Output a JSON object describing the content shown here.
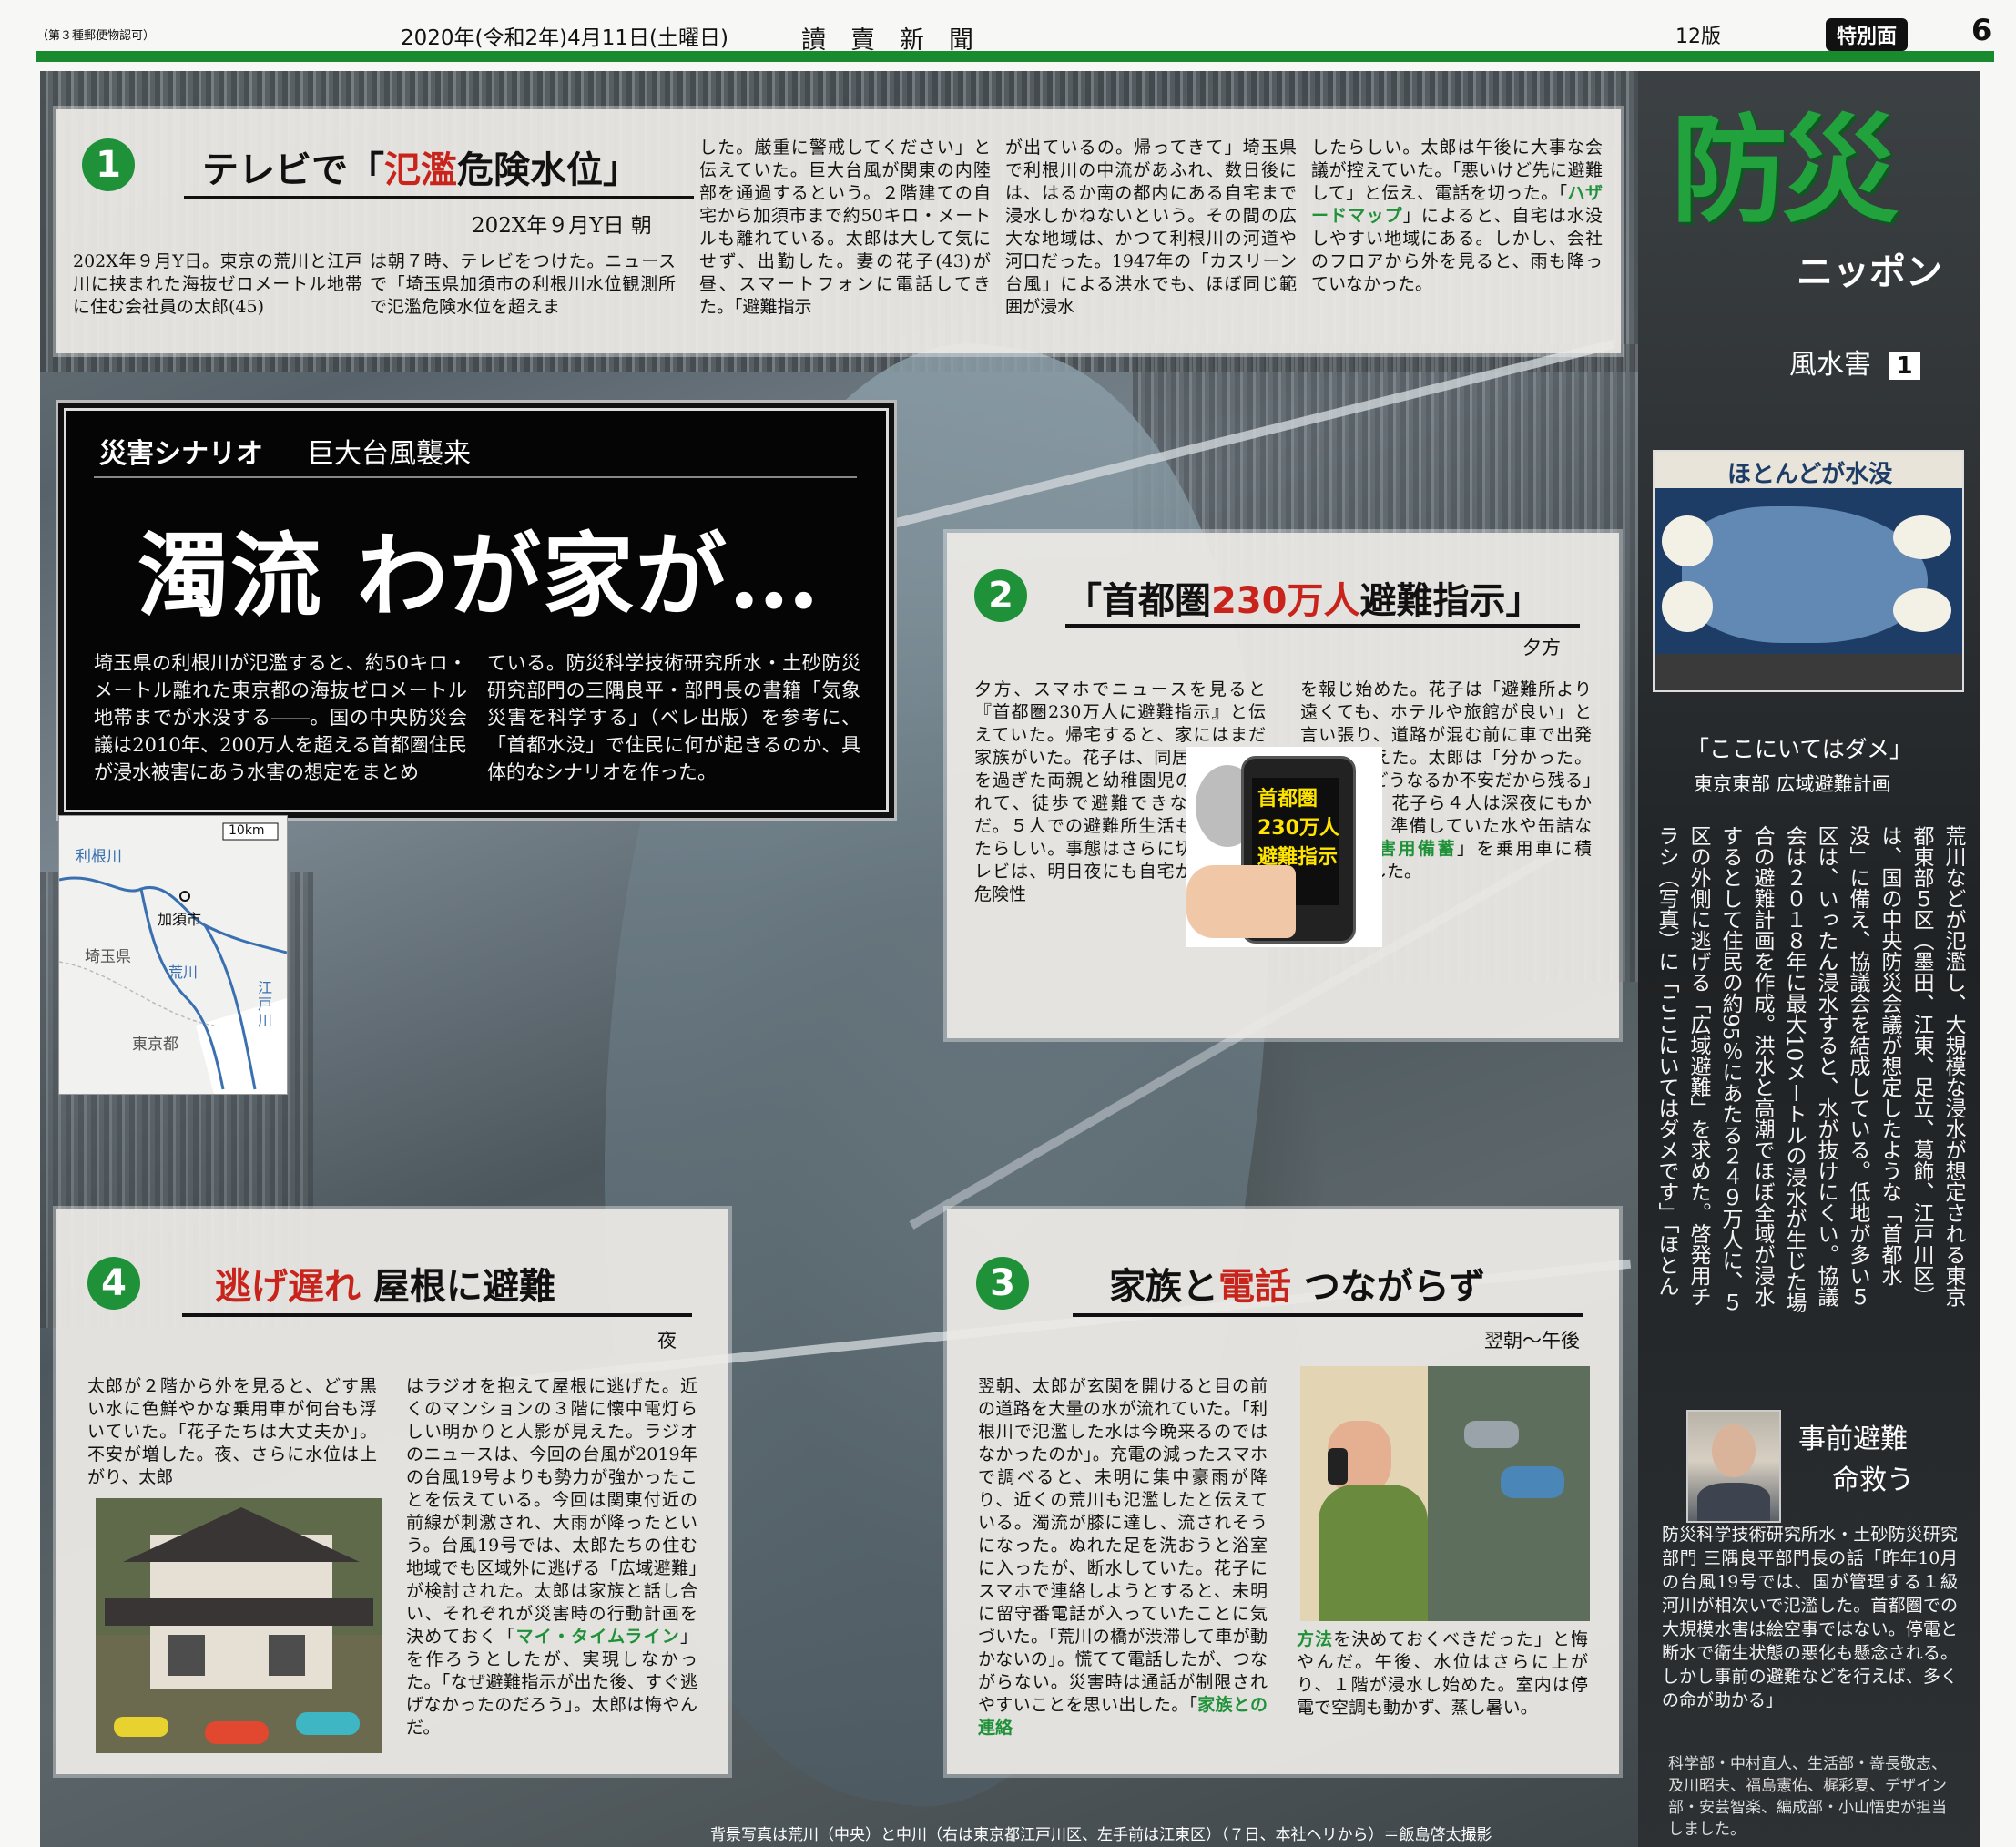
{
  "masthead": {
    "permit": "（第３種郵便物認可）",
    "date": "2020年(令和2年)4月11日(土曜日)",
    "paper": "讀　賣　新　聞",
    "edition": "12版",
    "section_badge": "特別面",
    "page": "6"
  },
  "series": {
    "title": "防災",
    "subtitle": "ニッポン",
    "topic": "風水害",
    "topic_no": "1"
  },
  "lead_panel": {
    "kicker": "災害シナリオ",
    "kicker2": "巨大台風襲来",
    "headline": "濁流 わが家が…",
    "lead_left": "埼玉県の利根川が氾濫すると、約50キロ・メートル離れた東京都の海抜ゼロメートル地帯までが水没する――。国の中央防災会議は2010年、200万人を超える首都圏住民が浸水被害にあう水害の想定をまとめ",
    "lead_right": "ている。防災科学技術研究所水・土砂防災研究部門の三隅良平・部門長の書籍「気象災害を科学する」（ベレ出版）を参考に、「首都水没」で住民に何が起きるのか、具体的なシナリオを作った。"
  },
  "map": {
    "scale": "10km",
    "tone_river": "利根川",
    "city": "加須市",
    "pref_saitama": "埼玉県",
    "ara": "荒川",
    "edo": "江戸川",
    "tokyo": "東京都"
  },
  "s1": {
    "num": "1",
    "head_pre": "テレビで「",
    "head_hl": "氾濫",
    "head_post": "危険水位」",
    "time": "202X年９月Y日 朝",
    "c1": "202X年９月Y日。東京の荒川と江戸川に挟まれた海抜ゼロメートル地帯に住む会社員の太郎(45)",
    "c2": "は朝７時、テレビをつけた。ニュースで「埼玉県加須市の利根川水位観測所で氾濫危険水位を超えま",
    "c3": "した。厳重に警戒してください」と伝えていた。巨大台風が関東の内陸部を通過するという。２階建ての自宅から加須市まで約50キロ・メートルも離れている。太郎は大して気にせず、出勤した。妻の花子(43)が昼、スマートフォンに電話してきた。「避難指示",
    "c4": "が出ているの。帰ってきて」埼玉県で利根川の中流があふれ、数日後には、はるか南の都内にある自宅まで浸水しかねないという。その間の広大な地域は、かつて利根川の河道や河口だった。1947年の「カスリーン台風」による洪水でも、ほぼ同じ範囲が浸水",
    "c5a": "したらしい。太郎は午後に大事な会議が控えていた。「悪いけど先に避難して」と伝え、電話を切った。「",
    "c5hl": "ハザードマップ",
    "c5b": "」によると、自宅は水没しやすい地域にある。しかし、会社のフロアから外を見ると、雨も降っていなかった。"
  },
  "s2": {
    "num": "2",
    "head_pre": "「首都圏",
    "head_hl": "230万人",
    "head_post": "避難指示」",
    "time": "夕方",
    "c1": "夕方、スマホでニュースを見ると『首都圏230万人に避難指示』と伝えていた。帰宅すると、家にはまだ家族がいた。花子は、同居する80歳を過ぎた両親と幼稚園児の長男を連れて、徒歩で避難できなかったのだ。５人での避難所生活も心配だったらしい。事態はさらに切迫し、テレビは、明日夜にも自宅が浸水する危険性",
    "c2a": "を報じ始めた。花子は「避難所より遠くても、ホテルや旅館が良い」と言い張り、道路が混む前に車で出発すると訴えた。太郎は「分かった。僕は家がどうなるか不安だから残る」と応じた。花子ら４人は深夜にもかかわらず、準備していた水や缶詰などの「",
    "c2hl": "災害用備蓄",
    "c2b": "」を乗用車に積み、出発した。",
    "phone_text": "首都圏 230万人 避難指示"
  },
  "s3": {
    "num": "3",
    "head_pre": "家族と",
    "head_hl": "電話",
    "head_post": " つながらず",
    "time": "翌朝～午後",
    "c1": "翌朝、太郎が玄関を開けると目の前の道路を大量の水が流れていた。「利根川で氾濫した水は今晩来るのではなかったのか」。充電の減ったスマホで調べると、未明に集中豪雨が降り、近くの荒川も氾濫したと伝えている。濁流が膝に達し、流されそうになった。ぬれた足を洗おうと浴室に入ったが、断水していた。花子にスマホで連絡しようとすると、未明に留守番電話が入っていたことに気づいた。「荒川の橋が渋滞して車が動かないの」。慌てて電話したが、つながらない。災害時は通話が制限されやすいことを思い出した。「",
    "c1hl": "家族との連絡",
    "c2hl": "方法",
    "c2": "を決めておくべきだった」と悔やんだ。午後、水位はさらに上がり、１階が浸水し始めた。室内は停電で空調も動かず、蒸し暑い。"
  },
  "s4": {
    "num": "4",
    "head_hl": "逃げ遅れ",
    "head_post": " 屋根に避難",
    "time": "夜",
    "c1": "太郎が２階から外を見ると、どす黒い水に色鮮やかな乗用車が何台も浮いていた。「花子たちは大丈夫か」。不安が増した。夜、さらに水位は上がり、太郎",
    "c2a": "はラジオを抱えて屋根に逃げた。近くのマンションの３階に懐中電灯らしい明かりと人影が見えた。ラジオのニュースは、今回の台風が2019年の台風19号よりも勢力が強かったことを伝えている。今回は関東付近の前線が刺激され、大雨が降ったという。台風19号では、太郎たちの住む地域でも区域外に逃げる「広域避難」が検討された。太郎は家族と話し合い、それぞれが災害時の行動計画を決めておく「",
    "c2hl": "マイ・タイムライン",
    "c2b": "」を作ろうとしたが、実現しなかった。「なぜ避難指示が出た後、すぐ逃げなかったのだろう」。太郎は悔やんだ。"
  },
  "sidebar": {
    "inset_title": "ほとんどが水没",
    "inset_caption": "「ここにいてはダメ」",
    "inset_source": "東京東部 広域避難計画",
    "vertical_text": "荒川などが氾濫し、大規模な浸水が想定される東京都東部５区（墨田、江東、足立、葛飾、江戸川区）は、国の中央防災会議が想定したような「首都水没」に備え、協議会を結成している。低地が多い５区は、いったん浸水すると、水が抜けにくい。協議会は２０１８年に最大10メートルの浸水が生じた場合の避難計画を作成。洪水と高潮でほぼ全域が浸水するとして住民の約95％にあたる２４９万人に、５区の外側に逃げる「広域避難」を求めた。啓発用チラシ（写真）に「ここにいてはダメです」「ほとんどが水没」などの警告文を載せ、備えの必要性を訴えた。",
    "expert_head1": "事前避難",
    "expert_head2": "命救う",
    "expert_text": "防災科学技術研究所水・土砂防災研究部門 三隅良平部門長の話「昨年10月の台風19号では、国が管理する１級河川が相次いで氾濫した。首都圏での大規模水害は絵空事ではない。停電と断水で衛生状態の悪化も懸念される。しかし事前の避難などを行えば、多くの命が助かる」",
    "credits": "科学部・中村直人、生活部・嵜長敬志、及川昭夫、福島憲佑、梶彩夏、デザイン部・安芸智楽、編成部・小山悟史が担当しました。"
  },
  "photo_credit": "背景写真は荒川（中央）と中川（右は東京都江戸川区、左手前は江東区）（７日、本社ヘリから）＝飯島啓太撮影"
}
